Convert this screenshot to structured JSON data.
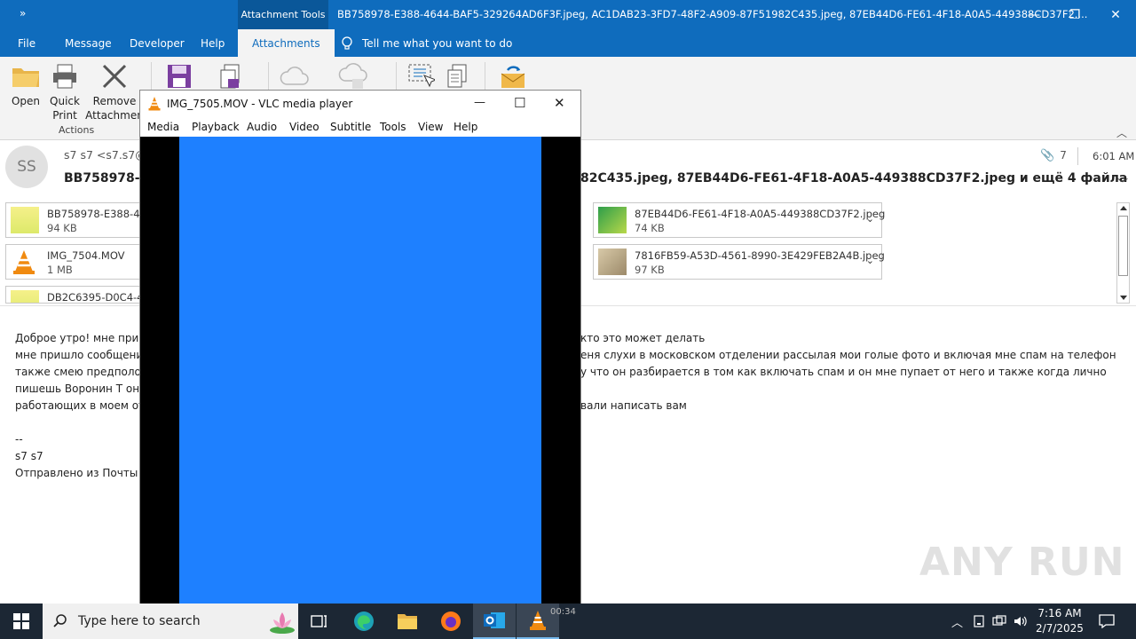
{
  "titlebar": {
    "quick_access": "»",
    "context_tab": "Attachment Tools",
    "title": "BB758978-E388-4644-BAF5-329264AD6F3F.jpeg, AC1DAB23-3FD7-48F2-A909-87F51982C435.jpeg, 87EB44D6-FE61-4F18-A0A5-449388CD37F2....",
    "minimize": "—",
    "restore": "❐",
    "close": "✕"
  },
  "tabs": [
    "File",
    "Message",
    "Developer",
    "Help",
    "Attachments"
  ],
  "tell_me": "Tell me what you want to do",
  "ribbon": {
    "open": "Open",
    "quick_print": [
      "Quick",
      "Print"
    ],
    "remove": [
      "Remove",
      "Attachmen"
    ],
    "group_actions": "Actions"
  },
  "mail": {
    "avatar_initials": "SS",
    "sender": "s7 s7 <s7.s7@",
    "subject_left": "BB758978-E3",
    "subject_right": "82C435.jpeg, 87EB44D6-FE61-4F18-A0A5-449388CD37F2.jpeg и ещё 4 файла",
    "attachment_count": "7",
    "time": "6:01 AM"
  },
  "attachments": [
    {
      "name": "BB758978-E388-4644",
      "size": "94 KB"
    },
    {
      "name": "87EB44D6-FE61-4F18-A0A5-449388CD37F2.jpeg",
      "size": "74 KB"
    },
    {
      "name": "IMG_7504.MOV",
      "size": "1 MB"
    },
    {
      "name": "7816FB59-A53D-4561-8990-3E429FEB2A4B.jpeg",
      "size": "97 KB"
    },
    {
      "name": "DB2C6395-D0C4-46",
      "size": ""
    }
  ],
  "body_left": [
    "Доброе утро! мне при",
    "мне пришло сообщени",
    "также смею предполо",
    "пишешь Воронин Т он",
    "работающих в моем от",
    "--",
    "s7 s7",
    "Отправлено из Почты"
  ],
  "body_right": [
    "кто это может делать",
    "еня слухи в  московском отделении рассылая мои голые фото и включая мне спам на телефон",
    "у что он разбирается в том как включать спам и он мне пупает от него и также когда лично",
    "",
    "вали написать вам"
  ],
  "vlc": {
    "title": "IMG_7505.MOV - VLC media player",
    "menu": [
      "Media",
      "Playback",
      "Audio",
      "Video",
      "Subtitle",
      "Tools",
      "View",
      "Help"
    ],
    "minimize": "—",
    "maximize": "☐",
    "close": "✕",
    "time": "00:34"
  },
  "taskbar": {
    "search_placeholder": "Type here to search",
    "time": "7:16 AM",
    "date": "2/7/2025"
  },
  "watermark": "ANY RUN"
}
